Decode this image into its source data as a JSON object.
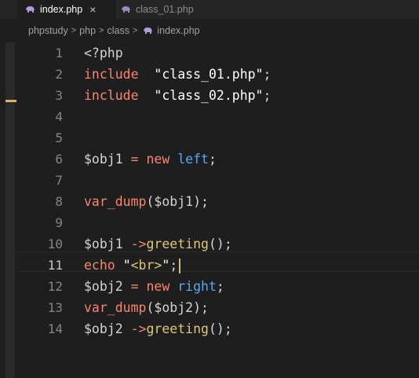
{
  "tabs": [
    {
      "label": "index.php",
      "active": true,
      "close": "×",
      "icon": "php-elephant-icon"
    },
    {
      "label": "class_01.php",
      "active": false,
      "icon": "php-elephant-icon"
    }
  ],
  "breadcrumb": [
    "phpstudy",
    "php",
    "class",
    "index.php"
  ],
  "breadcrumb_separator": ">",
  "colors": {
    "background": "#1e1e1e",
    "keyword": "#f48771",
    "string": "#ffffff",
    "function_call": "#dcc877",
    "class_name": "#5aa9f0",
    "operator": "#f48771",
    "punctuation": "#d4d4d4",
    "variable": "#d4d4d4",
    "line_number": "#858585",
    "gutter_mark": "#d9b65c",
    "php_icon": "#b39bdb"
  },
  "editor": {
    "current_line": 11,
    "lines": [
      {
        "n": "1",
        "tokens": [
          {
            "t": "<?php",
            "c": "punctuation"
          }
        ]
      },
      {
        "n": "2",
        "tokens": [
          {
            "t": "include",
            "c": "keyword"
          },
          {
            "t": "  ",
            "c": "punctuation"
          },
          {
            "t": "\"class_01.php\"",
            "c": "string"
          },
          {
            "t": ";",
            "c": "punctuation"
          }
        ]
      },
      {
        "n": "3",
        "tokens": [
          {
            "t": "include",
            "c": "keyword"
          },
          {
            "t": "  ",
            "c": "punctuation"
          },
          {
            "t": "\"class_02.php\"",
            "c": "string"
          },
          {
            "t": ";",
            "c": "punctuation"
          }
        ]
      },
      {
        "n": "4",
        "tokens": []
      },
      {
        "n": "5",
        "tokens": []
      },
      {
        "n": "6",
        "tokens": [
          {
            "t": "$obj1",
            "c": "variable"
          },
          {
            "t": " = ",
            "c": "operator"
          },
          {
            "t": "new",
            "c": "keyword"
          },
          {
            "t": " ",
            "c": "punctuation"
          },
          {
            "t": "left",
            "c": "class_name"
          },
          {
            "t": ";",
            "c": "punctuation"
          }
        ]
      },
      {
        "n": "7",
        "tokens": []
      },
      {
        "n": "8",
        "tokens": [
          {
            "t": "var_dump",
            "c": "keyword"
          },
          {
            "t": "(",
            "c": "punctuation"
          },
          {
            "t": "$obj1",
            "c": "variable"
          },
          {
            "t": ");",
            "c": "punctuation"
          }
        ]
      },
      {
        "n": "9",
        "tokens": []
      },
      {
        "n": "10",
        "tokens": [
          {
            "t": "$obj1",
            "c": "variable"
          },
          {
            "t": " ->",
            "c": "operator"
          },
          {
            "t": "greeting",
            "c": "function_call"
          },
          {
            "t": "();",
            "c": "punctuation"
          }
        ]
      },
      {
        "n": "11",
        "tokens": [
          {
            "t": "echo",
            "c": "keyword"
          },
          {
            "t": " ",
            "c": "punctuation"
          },
          {
            "t": "\"",
            "c": "string"
          },
          {
            "t": "<br>",
            "c": "function_call"
          },
          {
            "t": "\"",
            "c": "string"
          },
          {
            "t": ";",
            "c": "punctuation"
          }
        ],
        "cursor": true
      },
      {
        "n": "12",
        "tokens": [
          {
            "t": "$obj2",
            "c": "variable"
          },
          {
            "t": " = ",
            "c": "operator"
          },
          {
            "t": "new",
            "c": "keyword"
          },
          {
            "t": " ",
            "c": "punctuation"
          },
          {
            "t": "right",
            "c": "class_name"
          },
          {
            "t": ";",
            "c": "punctuation"
          }
        ]
      },
      {
        "n": "13",
        "tokens": [
          {
            "t": "var_dump",
            "c": "keyword"
          },
          {
            "t": "(",
            "c": "punctuation"
          },
          {
            "t": "$obj2",
            "c": "variable"
          },
          {
            "t": ");",
            "c": "punctuation"
          }
        ]
      },
      {
        "n": "14",
        "tokens": [
          {
            "t": "$obj2",
            "c": "variable"
          },
          {
            "t": " ->",
            "c": "operator"
          },
          {
            "t": "greeting",
            "c": "function_call"
          },
          {
            "t": "();",
            "c": "punctuation"
          }
        ]
      }
    ]
  }
}
